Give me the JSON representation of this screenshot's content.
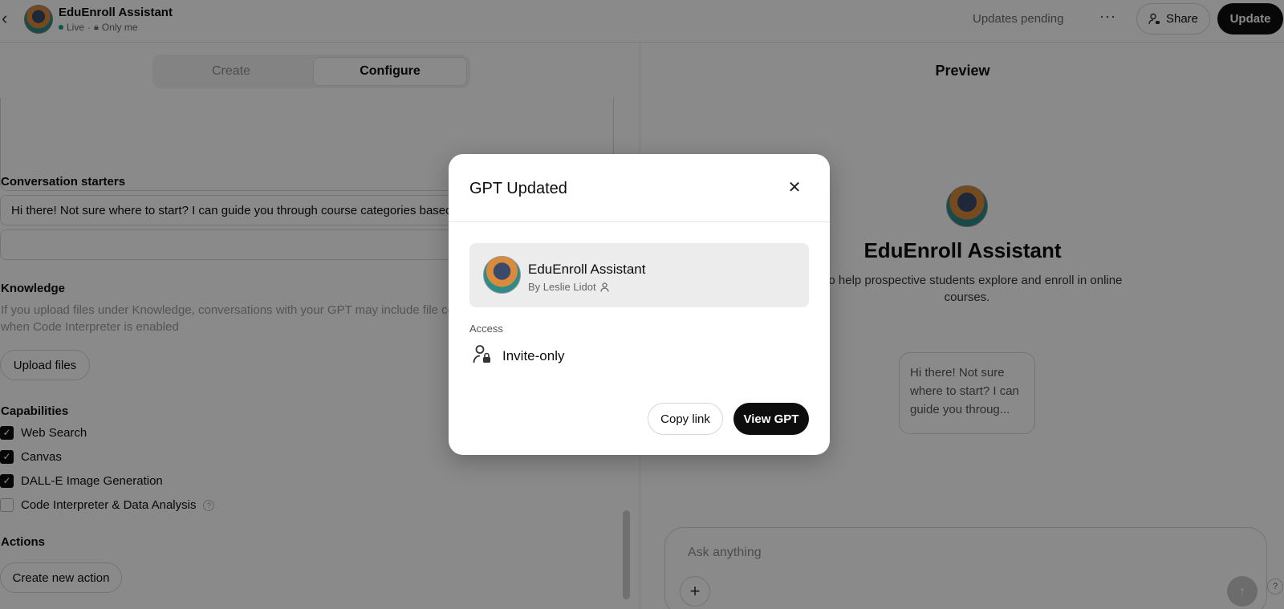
{
  "header": {
    "back_icon": "chevron-left-icon",
    "title": "EduEnroll Assistant",
    "status": "Live",
    "separator": "·",
    "visibility": "Only me",
    "pending": "Updates pending",
    "more": "···",
    "share_label": "Share",
    "update_label": "Update"
  },
  "editor": {
    "tabs": [
      {
        "label": "Create",
        "active": false
      },
      {
        "label": "Configure",
        "active": true
      }
    ],
    "conversation_starters_label": "Conversation starters",
    "starters": [
      "Hi there! Not sure where to start? I can guide you through course categories based",
      ""
    ],
    "knowledge_label": "Knowledge",
    "knowledge_help": "If you upload files under Knowledge, conversations with your GPT may include file cor",
    "knowledge_help_2": "when Code Interpreter is enabled",
    "upload_label": "Upload files",
    "capabilities_label": "Capabilities",
    "capabilities": [
      {
        "label": "Web Search",
        "checked": true
      },
      {
        "label": "Canvas",
        "checked": true
      },
      {
        "label": "DALL-E Image Generation",
        "checked": true
      },
      {
        "label": "Code Interpreter & Data Analysis",
        "checked": false
      }
    ],
    "actions_label": "Actions",
    "create_action_label": "Create new action"
  },
  "preview": {
    "title": "Preview",
    "name": "EduEnroll Assistant",
    "description": "ot to help prospective students explore and enroll in online courses.",
    "starter": "Hi there! Not sure where to start? I can guide you throug...",
    "composer_placeholder": "Ask anything",
    "help": "?"
  },
  "modal": {
    "title": "GPT Updated",
    "gpt_name": "EduEnroll Assistant",
    "byline": "By Leslie Lidot",
    "access_label": "Access",
    "access_value": "Invite-only",
    "copy_link_label": "Copy link",
    "view_label": "View GPT"
  }
}
